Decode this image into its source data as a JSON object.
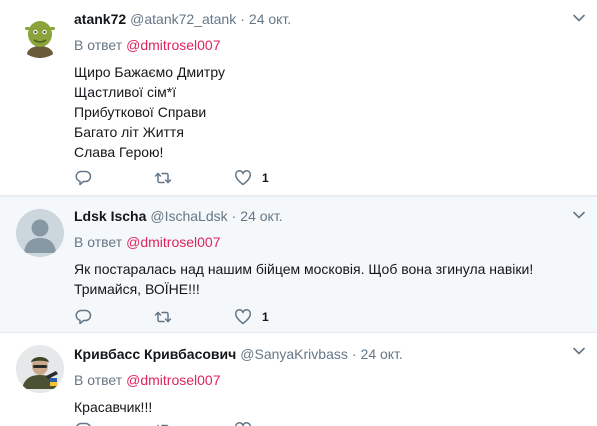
{
  "tweets": [
    {
      "fullname": "atank72",
      "username": "@atank72_atank",
      "separator": "·",
      "time": "24 окт.",
      "reply_prefix": "В ответ",
      "reply_mention": "@dmitrosel007",
      "lines": [
        "Щиро Бажаємо Дмитру",
        "Щастливої сім*ї",
        "Прибуткової Справи",
        "Багато літ Життя",
        "Слава Герою!"
      ],
      "like_count": "1"
    },
    {
      "fullname": "Ldsk Ischa",
      "username": "@IschaLdsk",
      "separator": "·",
      "time": "24 окт.",
      "reply_prefix": "В ответ",
      "reply_mention": "@dmitrosel007",
      "lines": [
        "Як постаралась над нашим бійцем московія. Щоб вона згинула навіки!",
        "Тримайся, ВОЇНЕ!!!"
      ],
      "like_count": "1"
    },
    {
      "fullname": "Кривбасс Кривбасович",
      "username": "@SanyaKrivbass",
      "separator": "·",
      "time": "24 окт.",
      "reply_prefix": "В ответ",
      "reply_mention": "@dmitrosel007",
      "lines": [
        "Красавчик!!!"
      ],
      "like_count": ""
    }
  ],
  "colors": {
    "mention": "#e0245e",
    "secondary_text": "#657786",
    "icon": "#657786",
    "highlight_background": "#f5f8fa"
  },
  "icons": [
    "reply-icon",
    "retweet-icon",
    "like-icon",
    "caret-down-icon"
  ]
}
